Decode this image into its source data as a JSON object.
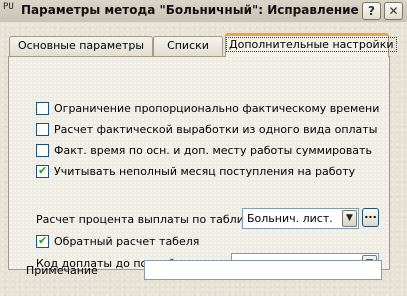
{
  "window": {
    "app_icon_text": "PU",
    "title": "Параметры метода \"Больничный\": Исправление",
    "help_symbol": "?",
    "close_symbol": "✕"
  },
  "tabs": [
    {
      "label": "Основные параметры",
      "selected": false
    },
    {
      "label": "Списки",
      "selected": false
    },
    {
      "label": "Дополнительные настройки",
      "selected": true
    }
  ],
  "options": [
    {
      "label": "Ограничение пропорционально фактическому времени",
      "checked": false
    },
    {
      "label": "Расчет фактической выработки из одного вида оплаты",
      "checked": false
    },
    {
      "label": "Факт. время по осн. и доп. месту работы суммировать",
      "checked": false
    },
    {
      "label": "Учитывать неполный месяц поступления на работу",
      "checked": true
    }
  ],
  "percent_table": {
    "label": "Расчет процента выплаты по таблице",
    "value": "Больнич. лист.",
    "browse_label": "..."
  },
  "reverse_timesheet": {
    "label": "Обратный расчет табеля",
    "checked": true
  },
  "surcharge_code": {
    "label": "Код доплаты до полной суммы",
    "value": ""
  },
  "note": {
    "label": "Примечание",
    "value": ""
  },
  "glyphs": {
    "check": "✔",
    "dropdown": "▼"
  },
  "colors": {
    "checkbox_border": "#1c5180",
    "check_mark": "#21a121",
    "selected_tab_accent": "#f2a33c",
    "field_border": "#7f9db9"
  }
}
